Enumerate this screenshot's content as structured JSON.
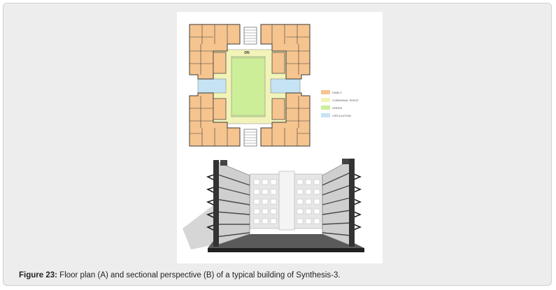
{
  "figure": {
    "label": "Figure 23:",
    "caption": " Floor plan (A) and sectional perspective (B) of a typical building of Synthesis-3."
  },
  "plan": {
    "north_label": "DN",
    "legend": [
      {
        "label": "FAMILY",
        "color": "#f6c48f"
      },
      {
        "label": "COMMUNAL SPACE",
        "color": "#f2f3b8"
      },
      {
        "label": "GREEN",
        "color": "#cdee98"
      },
      {
        "label": "CIRCULATION",
        "color": "#c5e3f3"
      }
    ]
  }
}
